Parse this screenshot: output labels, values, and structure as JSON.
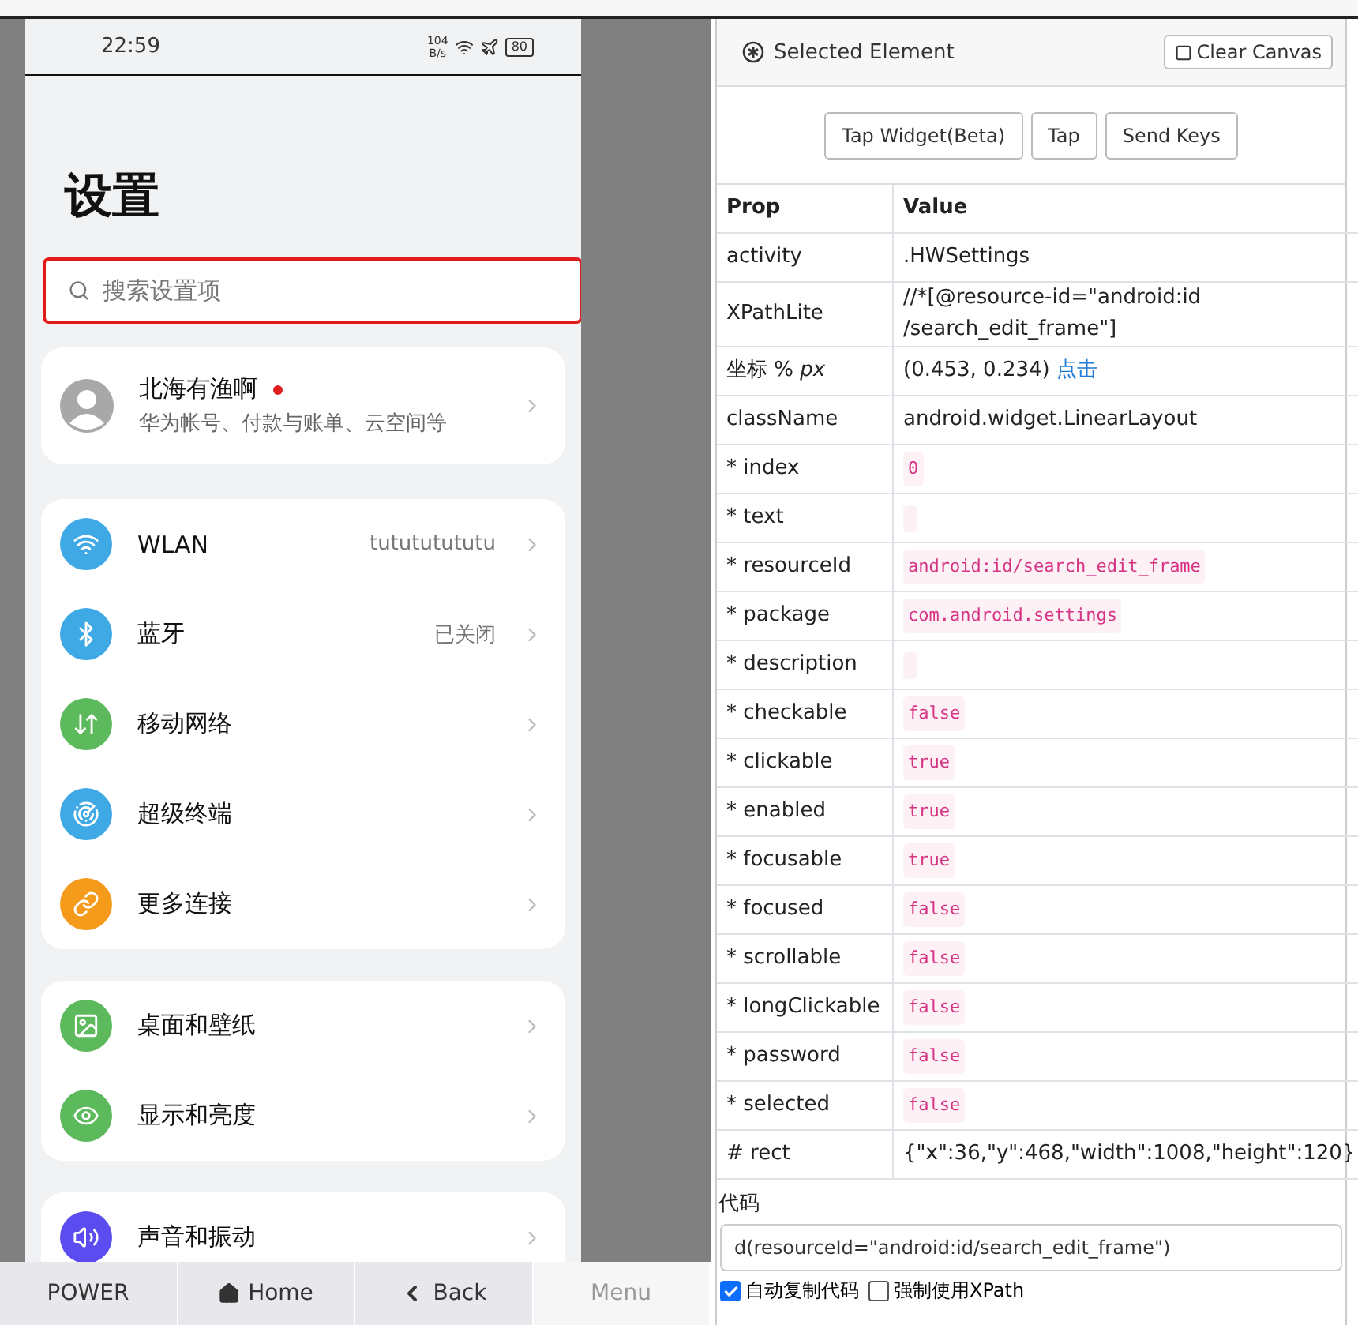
{
  "phone": {
    "status_bar": {
      "time": "22:59",
      "speed_value": "104",
      "speed_unit": "B/s",
      "battery": "80"
    },
    "title": "设置",
    "search": {
      "placeholder": "搜索设置项",
      "highlighted": true
    },
    "account": {
      "name": "北海有渔啊",
      "subtitle": "华为帐号、付款与账单、云空间等",
      "badge": true
    },
    "groups": [
      {
        "items": [
          {
            "kind": "wifi",
            "label": "WLAN",
            "value": "tutututututu",
            "color": "#3fa9e6"
          },
          {
            "kind": "bluetooth",
            "label": "蓝牙",
            "value": "已关闭",
            "color": "#3fa9e6"
          },
          {
            "kind": "arrows",
            "label": "移动网络",
            "color": "#5cba5c"
          },
          {
            "kind": "target",
            "label": "超级终端",
            "color": "#3fa9e6"
          },
          {
            "kind": "link",
            "label": "更多连接",
            "color": "#f59b1c"
          }
        ]
      },
      {
        "items": [
          {
            "kind": "image",
            "label": "桌面和壁纸",
            "color": "#5cba5c"
          },
          {
            "kind": "eye",
            "label": "显示和亮度",
            "color": "#5cba5c"
          }
        ]
      },
      {
        "items": [
          {
            "kind": "volume",
            "label": "声音和振动",
            "color": "#5b4cf0"
          }
        ]
      }
    ]
  },
  "nav_bar": [
    {
      "kind": "plain",
      "label": "POWER",
      "selected": false
    },
    {
      "kind": "home",
      "label": "Home",
      "selected": false
    },
    {
      "kind": "back",
      "label": "Back",
      "selected": false
    },
    {
      "kind": "plain",
      "label": "Menu",
      "selected": true
    }
  ],
  "inspector": {
    "title": "Selected Element",
    "clear_button": "Clear Canvas",
    "actions": [
      "Tap Widget(Beta)",
      "Tap",
      "Send Keys"
    ],
    "columns": [
      "Prop",
      "Value"
    ],
    "rows": [
      {
        "prop": "activity",
        "kind": "text",
        "value": ".HWSettings"
      },
      {
        "prop": "XPathLite",
        "kind": "text",
        "value": "//*[@resource-id=\"android:id\n/search_edit_frame\"]"
      },
      {
        "prop": "坐标 % *px*",
        "kind": "link",
        "value": "(0.453, 0.234)",
        "link": "点击"
      },
      {
        "prop": "className",
        "kind": "text",
        "value": "android.widget.LinearLayout"
      },
      {
        "prop": "* index",
        "kind": "code",
        "value": "0"
      },
      {
        "prop": "* text",
        "kind": "empty"
      },
      {
        "prop": "* resourceId",
        "kind": "code",
        "value": "android:id/search_edit_frame"
      },
      {
        "prop": "* package",
        "kind": "code",
        "value": "com.android.settings"
      },
      {
        "prop": "* description",
        "kind": "empty"
      },
      {
        "prop": "* checkable",
        "kind": "code",
        "value": "false"
      },
      {
        "prop": "* clickable",
        "kind": "code",
        "value": "true"
      },
      {
        "prop": "* enabled",
        "kind": "code",
        "value": "true"
      },
      {
        "prop": "* focusable",
        "kind": "code",
        "value": "true"
      },
      {
        "prop": "* focused",
        "kind": "code",
        "value": "false"
      },
      {
        "prop": "* scrollable",
        "kind": "code",
        "value": "false"
      },
      {
        "prop": "* longClickable",
        "kind": "code",
        "value": "false"
      },
      {
        "prop": "* password",
        "kind": "code",
        "value": "false"
      },
      {
        "prop": "* selected",
        "kind": "code",
        "value": "false"
      },
      {
        "prop": "# rect",
        "kind": "text",
        "value": "{\"x\":36,\"y\":468,\"width\":1008,\"height\":120}"
      }
    ],
    "code_label": "代码",
    "code_value": "d(resourceId=\"android:id/search_edit_frame\")",
    "options": [
      {
        "label": "自动复制代码",
        "checked": true
      },
      {
        "label": "强制使用XPath",
        "checked": false
      }
    ]
  }
}
